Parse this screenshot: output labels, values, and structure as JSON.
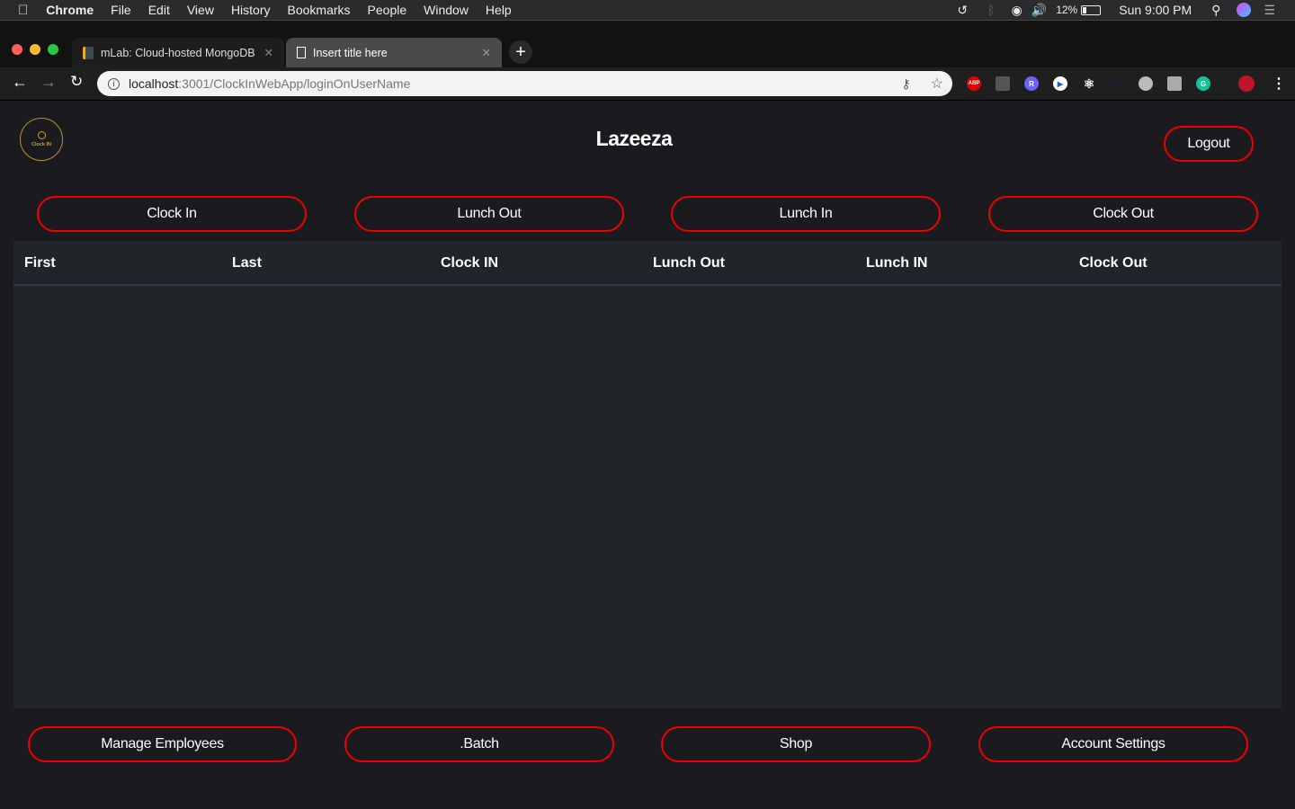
{
  "menubar": {
    "app": "Chrome",
    "items": [
      "File",
      "Edit",
      "View",
      "History",
      "Bookmarks",
      "People",
      "Window",
      "Help"
    ],
    "battery": "12%",
    "clock": "Sun 9:00 PM"
  },
  "tabs": [
    {
      "title": "mLab: Cloud-hosted MongoDB"
    },
    {
      "title": "Insert title here"
    }
  ],
  "address": {
    "host": "localhost",
    "rest": ":3001/ClockInWebApp/loginOnUserName"
  },
  "extensions": {
    "abp": "ABP",
    "r": "R"
  },
  "page": {
    "logo_text": "Clock IN",
    "title": "Lazeeza",
    "logout": "Logout",
    "actions": [
      "Clock In",
      "Lunch Out",
      "Lunch In",
      "Clock Out"
    ],
    "columns": [
      "First",
      "Last",
      "Clock IN",
      "Lunch Out",
      "Lunch IN",
      "Clock Out"
    ],
    "footer_buttons": [
      "Manage Employees",
      ".Batch",
      "Shop",
      "Account Settings"
    ]
  },
  "colors": {
    "accent": "#e00000",
    "logo": "#c9a227"
  }
}
